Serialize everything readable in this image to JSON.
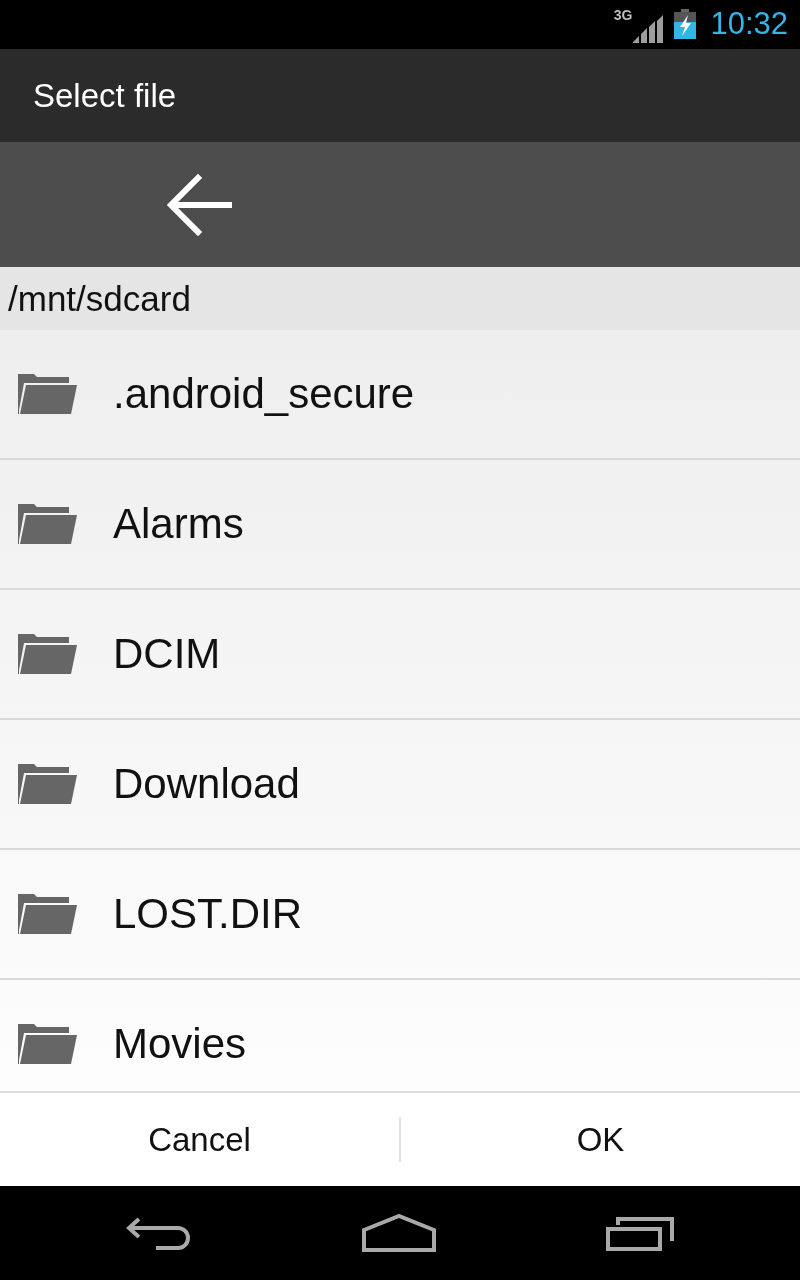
{
  "status_bar": {
    "network": "3G",
    "time": "10:32"
  },
  "title_bar": {
    "title": "Select file"
  },
  "path_bar": {
    "path": "/mnt/sdcard"
  },
  "file_list": {
    "items": [
      {
        "name": ".android_secure"
      },
      {
        "name": "Alarms"
      },
      {
        "name": "DCIM"
      },
      {
        "name": "Download"
      },
      {
        "name": "LOST.DIR"
      },
      {
        "name": "Movies"
      }
    ]
  },
  "buttons": [
    {
      "label": "Cancel"
    },
    {
      "label": "OK"
    }
  ]
}
